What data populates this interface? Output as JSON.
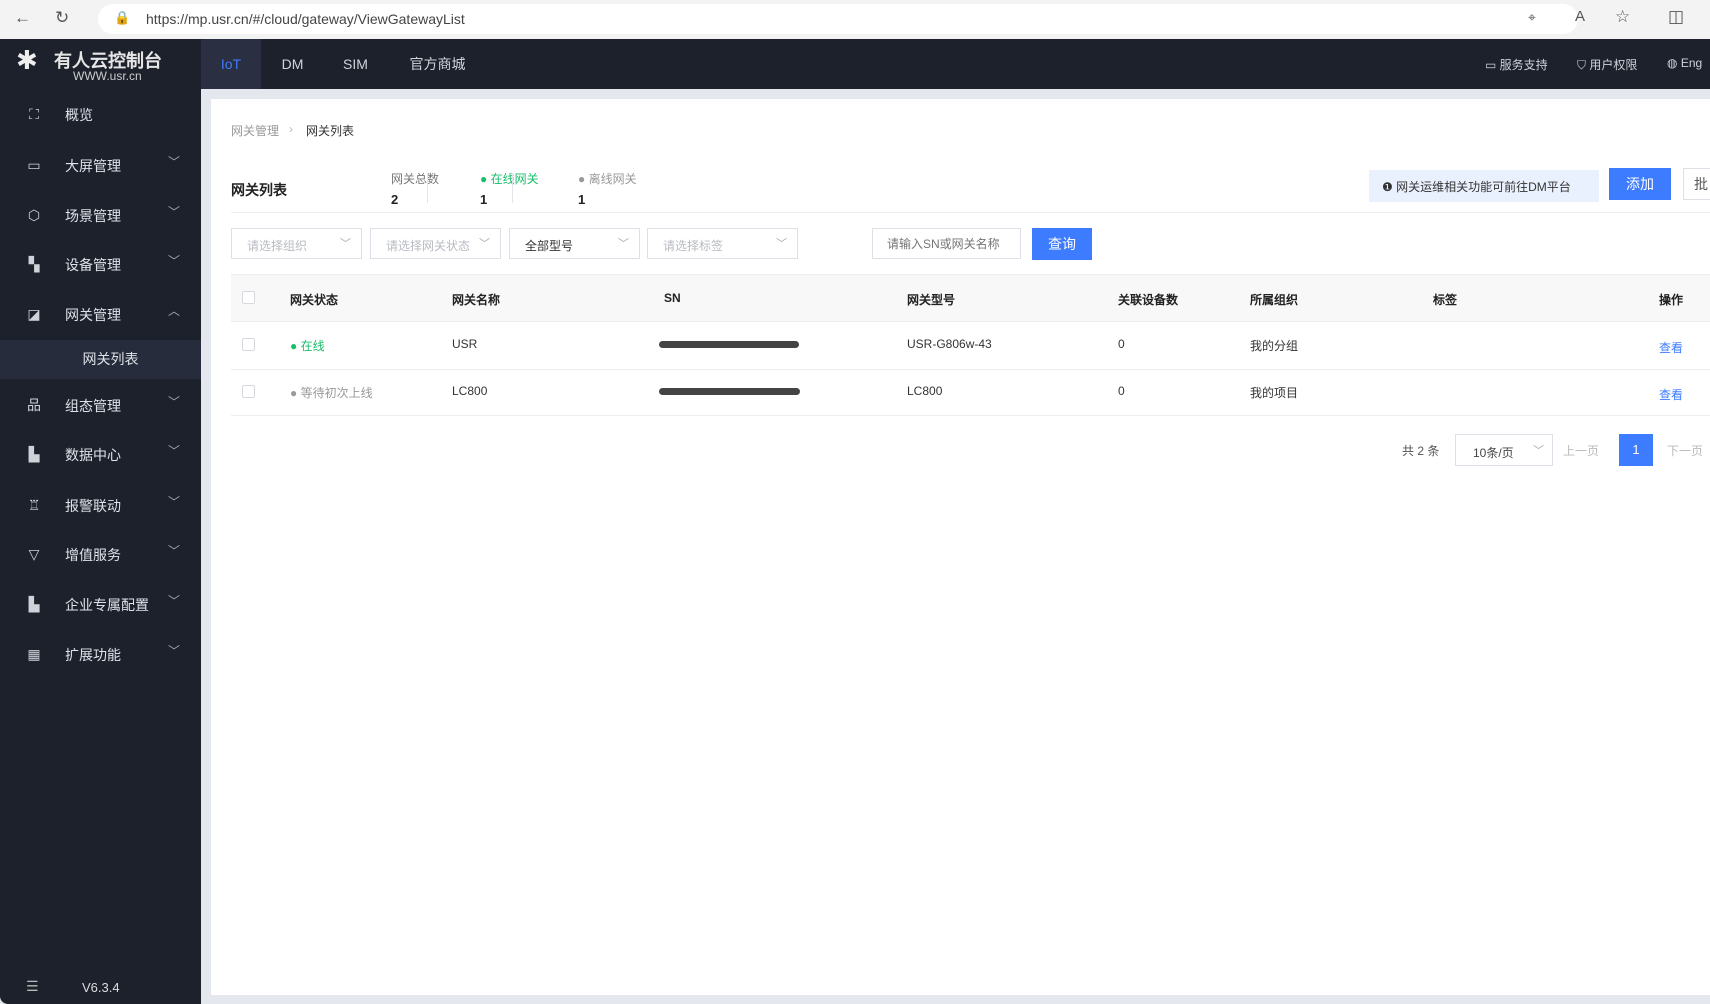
{
  "browser": {
    "url": "https://mp.usr.cn/#/cloud/gateway/ViewGatewayList"
  },
  "brand": {
    "title": "有人云控制台",
    "subtitle": "WWW.usr.cn"
  },
  "top_tabs": [
    {
      "label": "IoT",
      "active": true
    },
    {
      "label": "DM"
    },
    {
      "label": "SIM"
    },
    {
      "label": "官方商城"
    }
  ],
  "header_links": [
    {
      "label": "服务支持",
      "icon": "chat-icon"
    },
    {
      "label": "用户权限",
      "icon": "shield-icon"
    },
    {
      "label": "Eng",
      "icon": "globe-icon"
    }
  ],
  "sidebar": {
    "items": [
      {
        "label": "概览",
        "icon": "focus-icon"
      },
      {
        "label": "大屏管理",
        "icon": "monitor-icon"
      },
      {
        "label": "场景管理",
        "icon": "cube-icon"
      },
      {
        "label": "设备管理",
        "icon": "devices-icon"
      },
      {
        "label": "网关管理",
        "icon": "gateway-icon",
        "expanded": true
      },
      {
        "label": "组态管理",
        "icon": "hierarchy-icon"
      },
      {
        "label": "数据中心",
        "icon": "bar-chart-icon"
      },
      {
        "label": "报警联动",
        "icon": "alarm-icon"
      },
      {
        "label": "增值服务",
        "icon": "diamond-icon"
      },
      {
        "label": "企业专属配置",
        "icon": "building-icon"
      },
      {
        "label": "扩展功能",
        "icon": "grid-icon"
      }
    ],
    "sub_item": "网关列表",
    "version": "V6.3.4"
  },
  "breadcrumb": [
    "网关管理",
    "网关列表"
  ],
  "page_title": "网关列表",
  "stats": [
    {
      "label": "网关总数",
      "value": "2"
    },
    {
      "label": "在线网关",
      "value": "1",
      "color": "#19be6b"
    },
    {
      "label": "离线网关",
      "value": "1",
      "color": "#999999"
    }
  ],
  "notice": "网关运维相关功能可前往DM平台",
  "buttons": {
    "add": "添加",
    "batch": "批",
    "query": "查询"
  },
  "filters": {
    "org": "请选择组织",
    "status": "请选择网关状态",
    "model": "全部型号",
    "tag": "请选择标签",
    "search_placeholder": "请输入SN或网关名称"
  },
  "table": {
    "columns": [
      "网关状态",
      "网关名称",
      "SN",
      "网关型号",
      "关联设备数",
      "所属组织",
      "标签",
      "操作"
    ],
    "rows": [
      {
        "status": "在线",
        "status_color": "#19be6b",
        "name": "USR",
        "sn": "",
        "model": "USR-G806w-43",
        "devices": "0",
        "org": "我的分组",
        "tag": "",
        "action": "查看"
      },
      {
        "status": "等待初次上线",
        "status_color": "#999999",
        "name": "LC800",
        "sn": "",
        "model": "LC800",
        "devices": "0",
        "org": "我的项目",
        "tag": "",
        "action": "查看"
      }
    ]
  },
  "pagination": {
    "total": "共 2 条",
    "page_size": "10条/页",
    "prev": "上一页",
    "current": "1",
    "next": "下一页"
  },
  "colors": {
    "accent": "#3d7bff",
    "sidebar_bg": "#1d212c",
    "online": "#19be6b"
  }
}
